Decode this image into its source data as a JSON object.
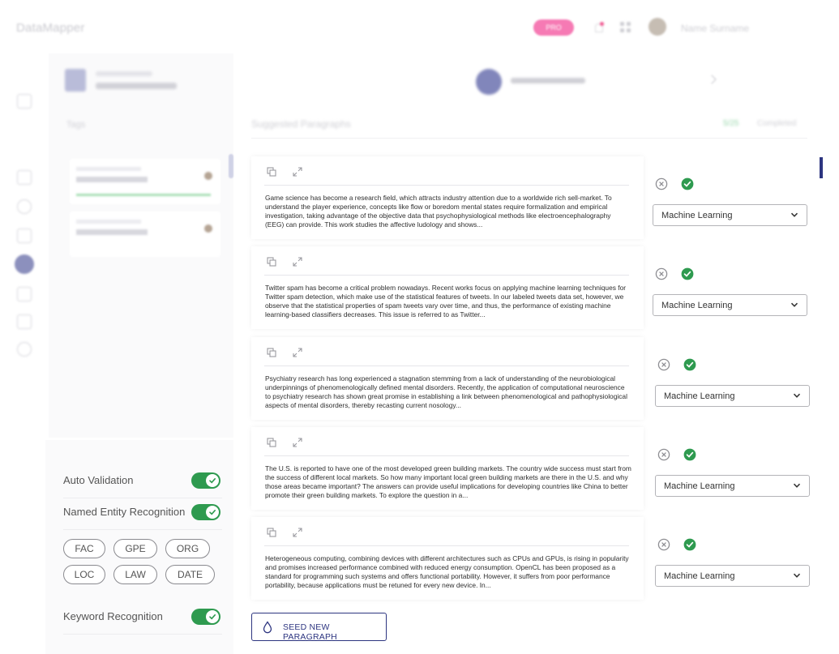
{
  "app": {
    "brand": "DataMapper",
    "plan_badge": "PRO",
    "user_name": "Name Surname"
  },
  "main": {
    "suggested_title": "Suggested Paragraphs",
    "progress_count": "5/25",
    "progress_label": "Completed"
  },
  "left_panel": {
    "section_title": "Tags"
  },
  "settings": {
    "auto_validation_label": "Auto Validation",
    "auto_validation_on": true,
    "ner_label": "Named Entity Recognition",
    "ner_on": true,
    "entity_chips": [
      "FAC",
      "GPE",
      "ORG",
      "LOC",
      "LAW",
      "DATE"
    ],
    "keyword_label": "Keyword Recognition",
    "keyword_on": true
  },
  "paragraphs": [
    {
      "text": "Game science has become a research field, which attracts industry attention due to a worldwide rich sell-market. To understand the player experience, concepts like flow or boredom mental states require formalization and empirical investigation, taking advantage of the objective data that psychophysiological methods like electroencephalography (EEG) can provide. This work studies the affective ludology and shows...",
      "category": "Machine Learning"
    },
    {
      "text": "Twitter spam has become a critical problem nowadays. Recent works focus on applying machine learning techniques for Twitter spam detection, which make use of the statistical features of tweets. In our labeled tweets data set, however, we observe that the statistical properties of spam tweets vary over time, and thus, the performance of existing machine learning-based classifiers decreases. This issue is referred to as Twitter...",
      "category": "Machine Learning"
    },
    {
      "text": "Psychiatry research has long experienced a stagnation stemming from a lack of understanding of the neurobiological underpinnings of phenomenologically defined mental disorders. Recently, the application of computational neuroscience to psychiatry research has shown great promise in establishing a link between phenomenological and pathophysiological aspects of mental disorders, thereby recasting current nosology...",
      "category": "Machine Learning"
    },
    {
      "text": "The U.S. is reported to have one of the most developed green building markets. The country wide success must start from the success of different local markets. So how many important local green building markets are there in the U.S. and why those areas became important? The answers can provide useful implications for developing countries like China to better promote their green building markets. To explore the question in a...",
      "category": "Machine Learning"
    },
    {
      "text": "Heterogeneous computing, combining devices with different architectures such as CPUs and GPUs, is rising in popularity and promises increased performance combined with reduced energy consumption. OpenCL has been proposed as a standard for programming such systems and offers functional portability. However, it suffers from poor performance portability, because applications must be retuned for every new device. In...",
      "category": "Machine Learning"
    }
  ],
  "seed_button_label": "SEED NEW PARAGRAPH",
  "colors": {
    "accent": "#2d3580",
    "success": "#2e9a4f",
    "badge": "#f67ab4"
  }
}
